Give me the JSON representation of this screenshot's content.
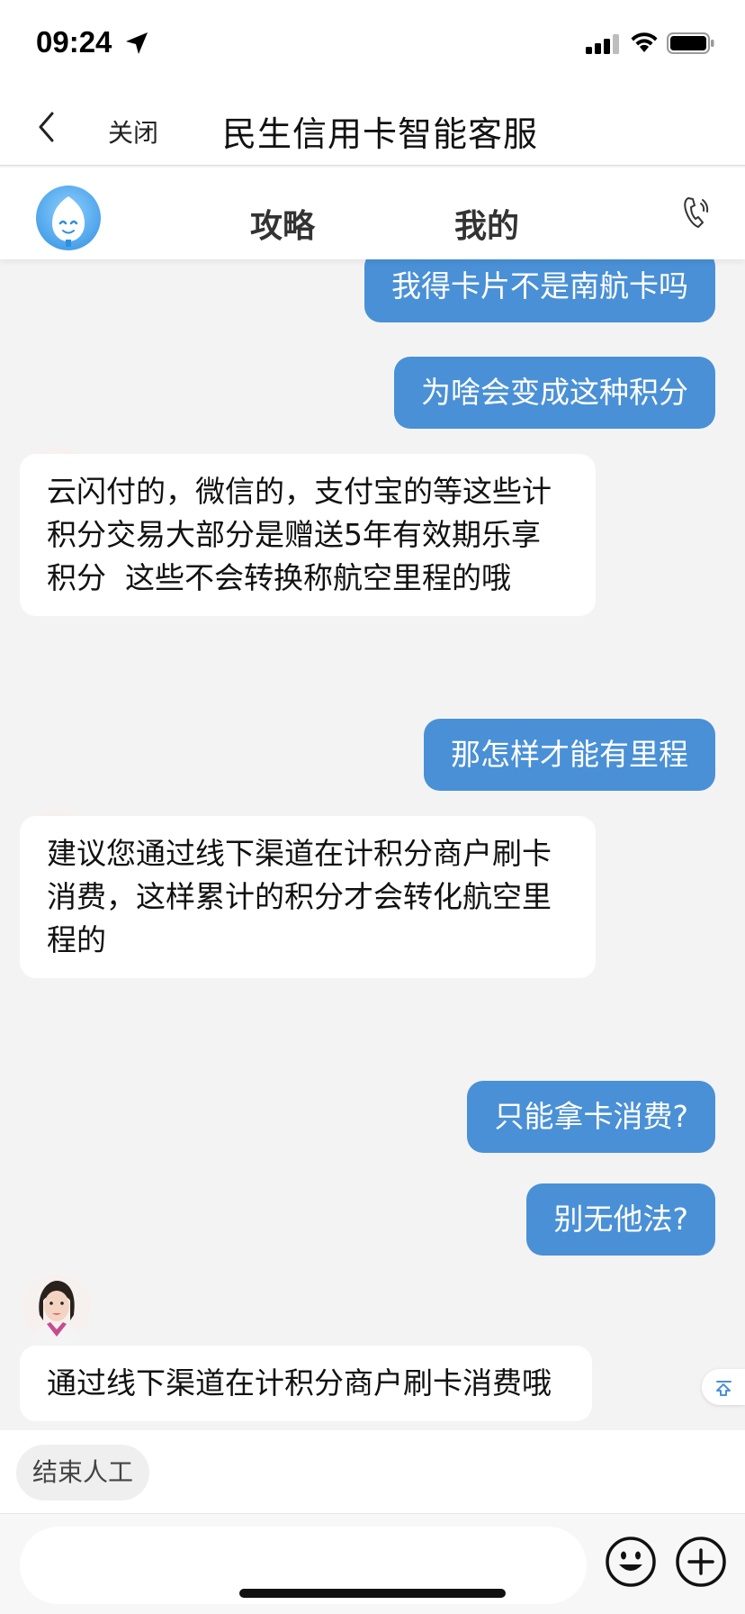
{
  "status_bar": {
    "time": "09:24"
  },
  "nav": {
    "close_label": "关闭",
    "title": "民生信用卡智能客服"
  },
  "tabs": [
    {
      "label": "攻略"
    },
    {
      "label": "我的"
    }
  ],
  "messages": [
    {
      "from": "user",
      "text": "我得卡片不是南航卡吗"
    },
    {
      "from": "user",
      "text": "为啥会变成这种积分"
    },
    {
      "from": "agent",
      "lines": [
        "云闪付的，微信的，支付宝的等这些计",
        "积分交易大部分是赠送5年有效期乐享",
        "积分  这些不会转换称航空里程的哦"
      ]
    },
    {
      "from": "user",
      "text": "那怎样才能有里程"
    },
    {
      "from": "agent",
      "lines": [
        "建议您通过线下渠道在计积分商户刷卡",
        "消费，这样累计的积分才会转化航空里",
        "程的"
      ]
    },
    {
      "from": "user",
      "text": "只能拿卡消费?"
    },
    {
      "from": "user",
      "text": "别无他法?"
    },
    {
      "from": "agent",
      "lines": [
        "通过线下渠道在计积分商户刷卡消费哦"
      ]
    }
  ],
  "quick_actions": {
    "end_human_label": "结束人工"
  },
  "input": {
    "placeholder": ""
  },
  "colors": {
    "user_bubble": "#4a90d6",
    "background": "#f3f3f4"
  }
}
